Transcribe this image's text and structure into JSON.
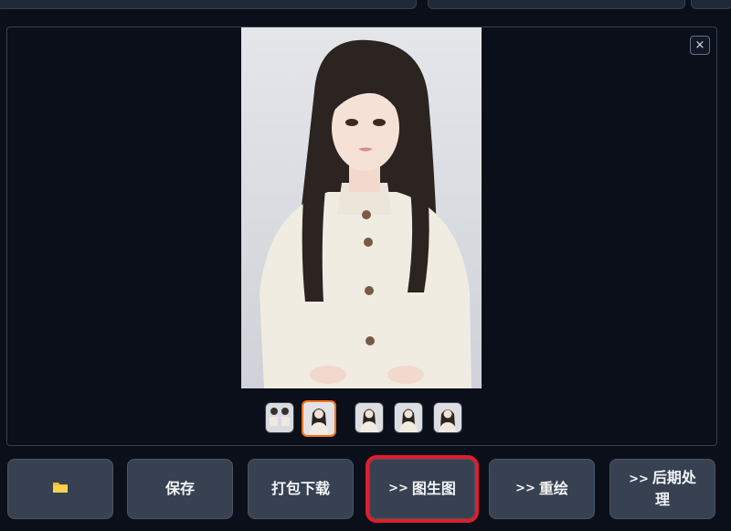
{
  "gallery": {
    "close_label": "×",
    "thumbnails": [
      "thumb-1",
      "thumb-2",
      "thumb-3",
      "thumb-4",
      "thumb-5"
    ],
    "selected_thumbnail": 2
  },
  "actions": {
    "open_folder_icon": "folder-icon",
    "save_label": "保存",
    "zip_download_label": "打包下载",
    "img2img_prefix": ">>",
    "img2img_label": "图生图",
    "inpaint_prefix": ">>",
    "inpaint_label": "重绘",
    "postprocess_prefix": ">>",
    "postprocess_label": "后期处理"
  },
  "colors": {
    "background": "#0b0f19",
    "button": "#374151",
    "selected_border": "#f97316",
    "highlight_box": "#e11d2e"
  }
}
